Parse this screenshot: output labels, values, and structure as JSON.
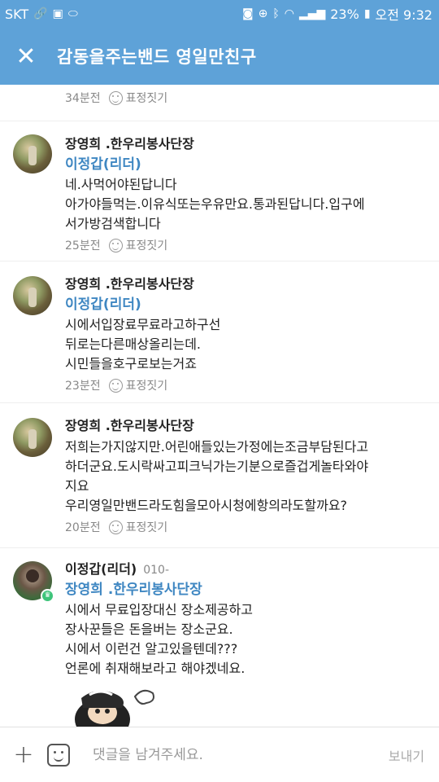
{
  "status_bar": {
    "carrier": "SKT",
    "battery": "23%",
    "time": "오전 9:32"
  },
  "app_bar": {
    "title": "감동을주는밴드 영일만친구"
  },
  "top_meta": {
    "time": "34분전",
    "react_label": "표정짓기"
  },
  "comments": [
    {
      "author": "장영희 .한우리봉사단장",
      "mention": "이정갑(리더)",
      "lines": [
        "네.사먹어야된답니다",
        "아가야들먹는.이유식또는우유만요.통과된답니다.입구에",
        "서가방검색합니다"
      ],
      "time": "25분전",
      "react_label": "표정짓기"
    },
    {
      "author": "장영희 .한우리봉사단장",
      "mention": "이정갑(리더)",
      "lines": [
        "시에서입장료무료라고하구선",
        "뒤로는다른매상올리는데.",
        "시민들을호구로보는거죠"
      ],
      "time": "23분전",
      "react_label": "표정짓기"
    },
    {
      "author": "장영희 .한우리봉사단장",
      "lines": [
        "저희는가지않지만.어린애들있는가정에는조금부담된다고",
        "하더군요.도시락싸고피크닉가는기분으로즐겁게놀타와야",
        "지요",
        "우리영일만밴드라도힘을모아시청에항의라도할까요?"
      ],
      "time": "20분전",
      "react_label": "표정짓기"
    },
    {
      "author": "이정갑(리더)",
      "phone": "010-",
      "mention": "장영희 .한우리봉사단장",
      "lines": [
        "시에서 무료입장대신 장소제공하고",
        "장사꾼들은 돈을버는 장소군요.",
        "시에서 이런건 알고있을텐데???",
        "언론에 취재해보라고 해야겠네요."
      ]
    }
  ],
  "input_bar": {
    "placeholder": "댓글을 남겨주세요.",
    "send_label": "보내기"
  },
  "colors": {
    "header": "#5ea2d8",
    "mention": "#3f87c2",
    "leader_badge": "#3ec47a"
  }
}
